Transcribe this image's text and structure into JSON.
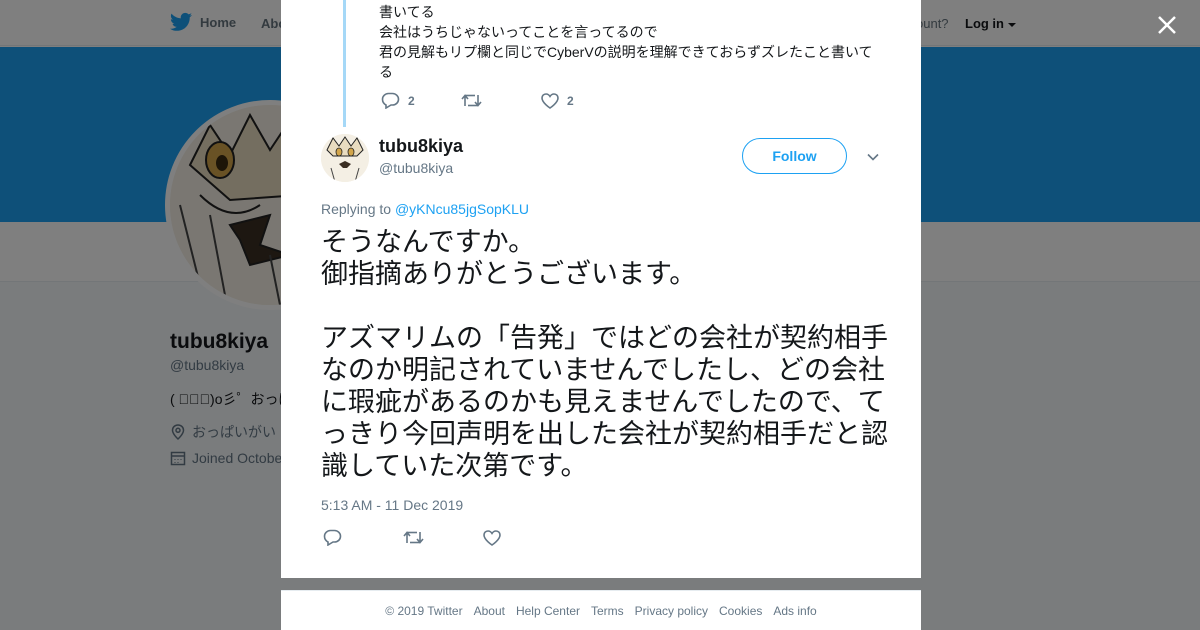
{
  "nav": {
    "home_label": "Home",
    "about_label": "Abo",
    "account_prompt": "ccount?",
    "login_label": "Log in"
  },
  "profile": {
    "name": "tubu8kiya",
    "handle": "@tubu8kiya",
    "bio": "( ﾟ∀ﾟ)o彡゜おっぱ",
    "location": "おっぱいがい",
    "joined": "Joined Octobe"
  },
  "previous_tweet": {
    "text_lines": [
      "書いてる",
      "会社はうちじゃないってことを言ってるので",
      "君の見解もリプ欄と同じでCyberVの説明を理解できておらずズレたこと書いて",
      "る"
    ],
    "reply_count": "2",
    "like_count": "2"
  },
  "tweet": {
    "author_name": "tubu8kiya",
    "author_handle": "@tubu8kiya",
    "follow_label": "Follow",
    "replying_to_label": "Replying to",
    "replying_to_handle": "@yKNcu85jgSopKLU",
    "text": "そうなんですか。\n御指摘ありがとうございます。\n\nアズマリムの「告発」ではどの会社が契約相手なのか明記されていませんでしたし、どの会社に瑕疵があるのかも見えませんでしたので、てっきり今回声明を出した会社が契約相手だと認識していた次第です。",
    "timestamp": "5:13 AM - 11 Dec 2019"
  },
  "footer": {
    "links": [
      "© 2019 Twitter",
      "About",
      "Help Center",
      "Terms",
      "Privacy policy",
      "Cookies",
      "Ads info"
    ]
  },
  "icons": {
    "brand": "twitter-bird-icon",
    "close": "close-icon",
    "reply": "reply-icon",
    "retweet": "retweet-icon",
    "like": "heart-icon",
    "more": "chevron-down-icon",
    "location": "location-pin-icon",
    "calendar": "calendar-icon"
  },
  "colors": {
    "accent": "#1da1f2",
    "thread_line": "#a5d8f7",
    "overlay": "rgba(0,0,0,0.5)"
  }
}
